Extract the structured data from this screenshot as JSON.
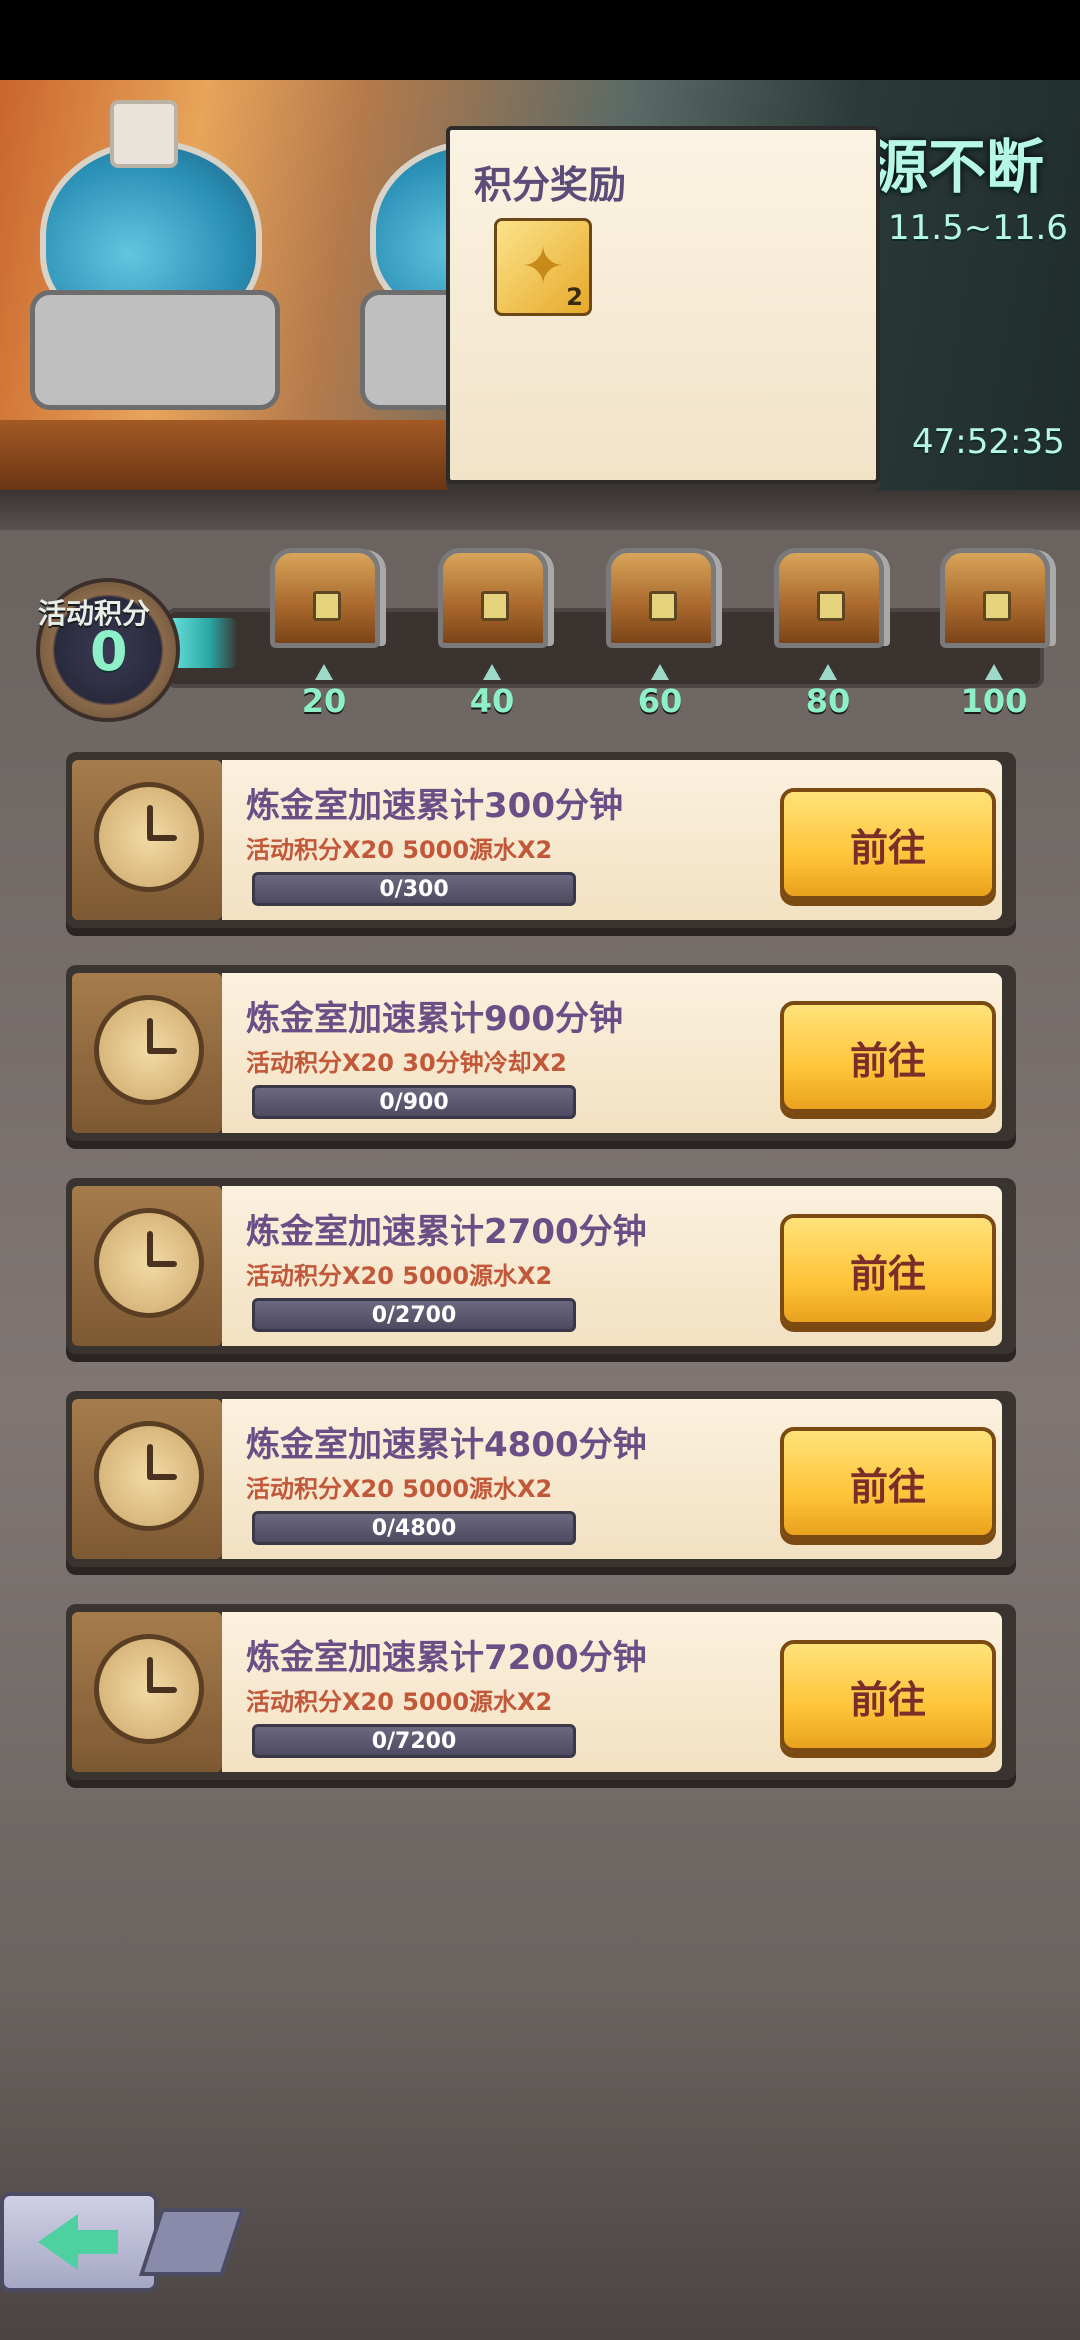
{
  "banner": {
    "title": "源不断",
    "dates": "11.5~11.6",
    "timer": "47:52:35"
  },
  "popup": {
    "title": "积分奖励",
    "item": {
      "icon": "puzzle-piece-icon",
      "count": "2"
    }
  },
  "progress": {
    "score_label": "活动积分",
    "score_value": "0",
    "milestones": [
      "20",
      "40",
      "60",
      "80",
      "100"
    ]
  },
  "tasks": [
    {
      "title": "炼金室加速累计300分钟",
      "reward": "活动积分X20 5000源水X2",
      "progress": "0/300",
      "button": "前往"
    },
    {
      "title": "炼金室加速累计900分钟",
      "reward": "活动积分X20 30分钟冷却X2",
      "progress": "0/900",
      "button": "前往"
    },
    {
      "title": "炼金室加速累计2700分钟",
      "reward": "活动积分X20 5000源水X2",
      "progress": "0/2700",
      "button": "前往"
    },
    {
      "title": "炼金室加速累计4800分钟",
      "reward": "活动积分X20 5000源水X2",
      "progress": "0/4800",
      "button": "前往"
    },
    {
      "title": "炼金室加速累计7200分钟",
      "reward": "活动积分X20 5000源水X2",
      "progress": "0/7200",
      "button": "前往"
    }
  ],
  "colors": {
    "accent_green": "#8ef0c8",
    "button_yellow": "#ffc53a",
    "title_purple": "#6a4f86"
  }
}
